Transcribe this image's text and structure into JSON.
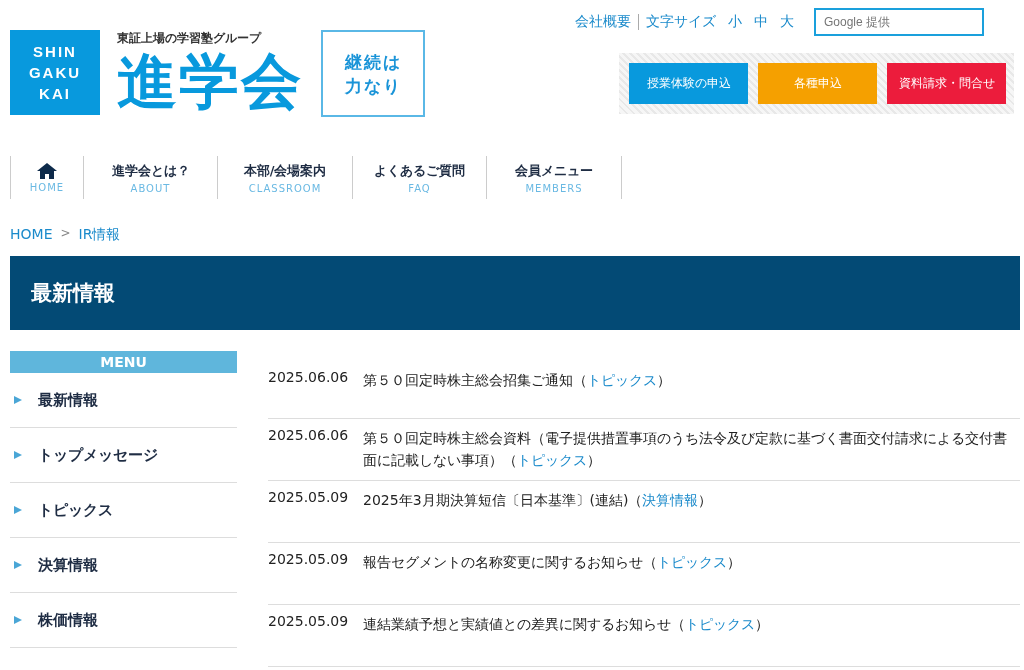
{
  "logo": {
    "mark_lines": [
      "SHIN",
      "GAKU",
      "KAI"
    ],
    "tagline": "東証上場の学習塾グループ",
    "name": "進学会",
    "motto_lines": [
      "継続は",
      "力なり"
    ]
  },
  "top_links": [
    {
      "label": "会社概要"
    },
    {
      "label": "文字サイズ"
    }
  ],
  "font_sizes": [
    {
      "label": "小"
    },
    {
      "label": "中"
    },
    {
      "label": "大"
    }
  ],
  "search": {
    "placeholder": "Google 提供"
  },
  "action_buttons": [
    {
      "label": "授業体験の申込",
      "color": "#0899dd"
    },
    {
      "label": "各種申込",
      "color": "#f5a000"
    },
    {
      "label": "資料請求・問合せ",
      "color": "#ec1c3c"
    }
  ],
  "nav": [
    {
      "kind": "icon",
      "sub": "HOME"
    },
    {
      "kind": "text",
      "label": "進学会とは？",
      "sub": "ABOUT"
    },
    {
      "kind": "text",
      "label": "本部/会場案内",
      "sub": "CLASSROOM"
    },
    {
      "kind": "text",
      "label": "よくあるご質問",
      "sub": "FAQ"
    },
    {
      "kind": "text",
      "label": "会員メニュー",
      "sub": "MEMBERS"
    }
  ],
  "breadcrumb": [
    {
      "label": "HOME"
    },
    {
      "label": "IR情報"
    }
  ],
  "breadcrumb_separator": ">",
  "page_title": "最新情報",
  "menu": {
    "heading": "MENU",
    "items": [
      {
        "label": "最新情報"
      },
      {
        "label": "トップメッセージ"
      },
      {
        "label": "トピックス"
      },
      {
        "label": "決算情報"
      },
      {
        "label": "株価情報"
      }
    ]
  },
  "news": [
    {
      "date": "2025.06.06",
      "text": "第５０回定時株主総会招集ご通知（",
      "link": "トピックス",
      "after": "）"
    },
    {
      "date": "2025.06.06",
      "text": "第５０回定時株主総会資料（電子提供措置事項のうち法令及び定款に基づく書面交付請求による交付書面に記載しない事項）（",
      "link": "トピックス",
      "after": "）"
    },
    {
      "date": "2025.05.09",
      "text": "2025年3月期決算短信〔日本基準〕(連結)（",
      "link": "決算情報",
      "after": "）"
    },
    {
      "date": "2025.05.09",
      "text": "報告セグメントの名称変更に関するお知らせ（",
      "link": "トピックス",
      "after": "）"
    },
    {
      "date": "2025.05.09",
      "text": "連結業績予想と実績値との差異に関するお知らせ（",
      "link": "トピックス",
      "after": "）"
    }
  ]
}
